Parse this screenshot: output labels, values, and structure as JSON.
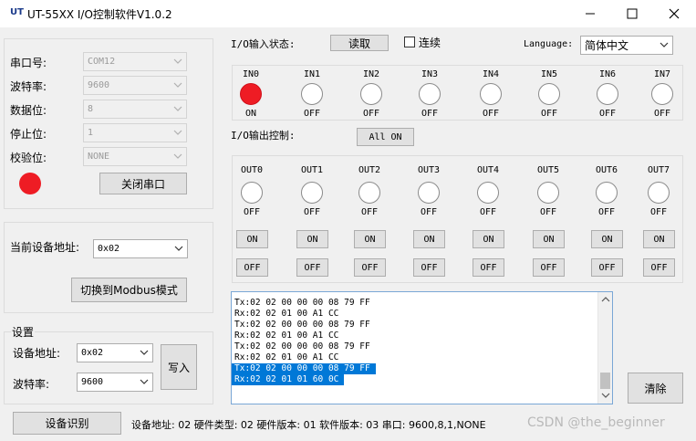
{
  "window": {
    "logo": "UT",
    "title": "UT-55XX I/O控制软件V1.0.2"
  },
  "serial": {
    "port_label": "串口号:",
    "port_value": "COM12",
    "baud_label": "波特率:",
    "baud_value": "9600",
    "databits_label": "数据位:",
    "databits_value": "8",
    "stopbits_label": "停止位:",
    "stopbits_value": "1",
    "parity_label": "校验位:",
    "parity_value": "NONE",
    "status_color": "#ee1c24",
    "close_button": "关闭串口"
  },
  "device": {
    "addr_label": "当前设备地址:",
    "addr_value": "0x02",
    "modbus_button": "切换到Modbus模式"
  },
  "settings": {
    "group_title": "设置",
    "addr_label": "设备地址:",
    "addr_value": "0x02",
    "baud_label": "波特率:",
    "baud_value": "9600",
    "write_button": "写入"
  },
  "input": {
    "status_label": "I/O输入状态:",
    "read_button": "读取",
    "continuous_label": "连续",
    "language_label": "Language:",
    "language_value": "简体中文",
    "channels": [
      {
        "name": "IN0",
        "state": "ON",
        "on": true
      },
      {
        "name": "IN1",
        "state": "OFF",
        "on": false
      },
      {
        "name": "IN2",
        "state": "OFF",
        "on": false
      },
      {
        "name": "IN3",
        "state": "OFF",
        "on": false
      },
      {
        "name": "IN4",
        "state": "OFF",
        "on": false
      },
      {
        "name": "IN5",
        "state": "OFF",
        "on": false
      },
      {
        "name": "IN6",
        "state": "OFF",
        "on": false
      },
      {
        "name": "IN7",
        "state": "OFF",
        "on": false
      }
    ]
  },
  "output": {
    "control_label": "I/O输出控制:",
    "all_on_button": "All ON",
    "channels": [
      {
        "name": "OUT0",
        "state": "OFF",
        "on_label": "ON",
        "off_label": "OFF"
      },
      {
        "name": "OUT1",
        "state": "OFF",
        "on_label": "ON",
        "off_label": "OFF"
      },
      {
        "name": "OUT2",
        "state": "OFF",
        "on_label": "ON",
        "off_label": "OFF"
      },
      {
        "name": "OUT3",
        "state": "OFF",
        "on_label": "ON",
        "off_label": "OFF"
      },
      {
        "name": "OUT4",
        "state": "OFF",
        "on_label": "ON",
        "off_label": "OFF"
      },
      {
        "name": "OUT5",
        "state": "OFF",
        "on_label": "ON",
        "off_label": "OFF"
      },
      {
        "name": "OUT6",
        "state": "OFF",
        "on_label": "ON",
        "off_label": "OFF"
      },
      {
        "name": "OUT7",
        "state": "OFF",
        "on_label": "ON",
        "off_label": "OFF"
      }
    ]
  },
  "log": {
    "lines": [
      {
        "text": "Tx:02 02 00 00 00 08 79 FF",
        "selected": false
      },
      {
        "text": "Rx:02 02 01 00 A1 CC",
        "selected": false
      },
      {
        "text": "Tx:02 02 00 00 00 08 79 FF",
        "selected": false
      },
      {
        "text": "Rx:02 02 01 00 A1 CC",
        "selected": false
      },
      {
        "text": "Tx:02 02 00 00 00 08 79 FF",
        "selected": false
      },
      {
        "text": "Rx:02 02 01 00 A1 CC",
        "selected": false
      },
      {
        "text": "Tx:02 02 00 00 00 08 79 FF",
        "selected": true
      },
      {
        "text": "Rx:02 02 01 01 60 0C",
        "selected": true
      }
    ],
    "clear_button": "清除"
  },
  "statusbar": {
    "identify_button": "设备识别",
    "info": "设备地址: 02  硬件类型: 02  硬件版本: 01  软件版本: 03  串口: 9600,8,1,NONE"
  },
  "watermark": "CSDN @the_beginner"
}
